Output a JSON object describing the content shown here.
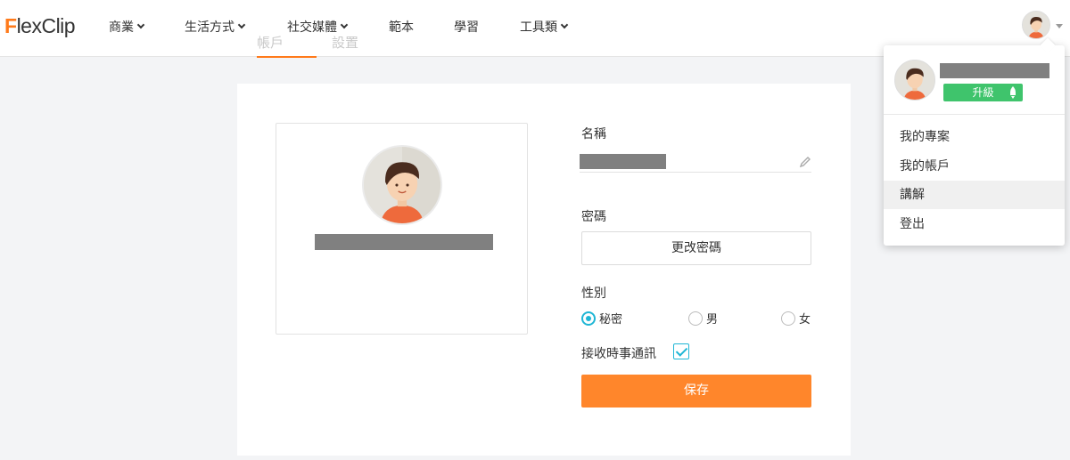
{
  "header": {
    "logo_mark": "F",
    "logo_rest": "lexClip",
    "nav": [
      "商業",
      "生活方式",
      "社交媒體",
      "範本",
      "學習",
      "工具類"
    ],
    "sub_tabs": [
      "帳戶",
      "設置"
    ]
  },
  "form": {
    "name_label": "名稱",
    "password_label": "密碼",
    "change_password": "更改密碼",
    "gender_label": "性別",
    "gender_options": [
      "秘密",
      "男",
      "女"
    ],
    "gender_selected": "秘密",
    "newsletter_label": "接收時事通訊",
    "newsletter_checked": true,
    "save": "保存"
  },
  "dropdown": {
    "upgrade": "升級",
    "items": [
      "我的專案",
      "我的帳戶",
      "講解",
      "登出"
    ],
    "active_item": "講解"
  },
  "colors": {
    "accent": "#ff7a1a",
    "save": "#ff862b",
    "upgrade": "#3fc46c",
    "radio": "#1fb6d5",
    "redacted": "#808080"
  }
}
